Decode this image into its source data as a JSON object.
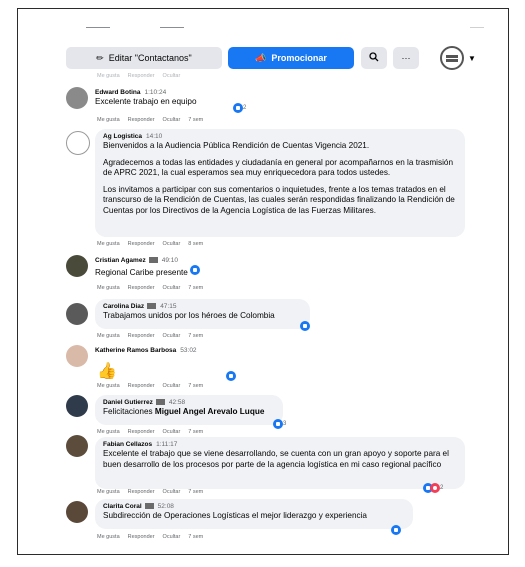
{
  "toolbar": {
    "edit_label": "Editar \"Contactanos\"",
    "promo_label": "Promocionar",
    "more_label": "···",
    "search_icon": "search-icon",
    "edit_icon": "pencil-icon",
    "promo_icon": "megaphone-icon"
  },
  "comments": [
    {
      "author": "Edward Botina",
      "time": "1:10:24",
      "text": "Excelente trabajo en equipo",
      "reactions": "2",
      "actions": [
        "Me gusta",
        "Responder",
        "Ocultar",
        "7 sem"
      ]
    },
    {
      "author": "Ag Logistica",
      "time": "14:10",
      "paragraphs": [
        "Bienvenidos a la Audiencia Pública Rendición de Cuentas Vigencia 2021.",
        "Agradecemos a todas las entidades y ciudadanía en general por acompañarnos en la trasmisión de APRC 2021, la cual esperamos sea muy enriquecedora para todos ustedes.",
        "Los invitamos a participar con sus comentarios o inquietudes, frente a los temas tratados en el transcurso de la Rendición de Cuentas, las cuales serán respondidas finalizando la Rendición de Cuentas por los Directivos de la Agencia Logística de las Fuerzas Militares."
      ],
      "actions": [
        "Me gusta",
        "Responder",
        "Ocultar",
        "8 sem"
      ]
    },
    {
      "author": "Cristian Agamez",
      "time": "49:10",
      "text": "Regional Caribe presente",
      "reactions": "",
      "actions": [
        "Me gusta",
        "Responder",
        "Ocultar",
        "7 sem"
      ]
    },
    {
      "author": "Carolina Diaz",
      "time": "47:15",
      "text": "Trabajamos unidos por los héroes de Colombia",
      "reactions": "",
      "actions": [
        "Me gusta",
        "Responder",
        "Ocultar",
        "7 sem"
      ]
    },
    {
      "author": "Katherine Ramos Barbosa",
      "time": "53:02",
      "text": "👍",
      "reactions": "",
      "actions": [
        "Me gusta",
        "Responder",
        "Ocultar",
        "7 sem"
      ]
    },
    {
      "author": "Daniel Gutierrez",
      "time": "42:58",
      "text_prefix": "Felicitaciones ",
      "text_bold": "Miguel Angel Arevalo Luque",
      "reactions": "3",
      "actions": [
        "Me gusta",
        "Responder",
        "Ocultar",
        "7 sem"
      ]
    },
    {
      "author": "Fabian Cellazos",
      "time": "1:11:17",
      "text": "Excelente el trabajo que se viene desarrollando, se cuenta con un gran apoyo y soporte para el buen desarrollo de los procesos por parte de la agencia logística en mi caso regional pacífico",
      "reactions": "2",
      "actions": [
        "Me gusta",
        "Responder",
        "Ocultar",
        "7 sem"
      ]
    },
    {
      "author": "Clarita Coral",
      "time": "52:08",
      "text": "Subdirección de Operaciones Logísticas el mejor liderazgo y experiencia",
      "reactions": "",
      "actions": [
        "Me gusta",
        "Responder",
        "Ocultar",
        "7 sem"
      ]
    }
  ],
  "colors": {
    "primary": "#1877f2",
    "bubble": "#f0f2f5",
    "text": "#050505",
    "muted": "#65676b"
  }
}
